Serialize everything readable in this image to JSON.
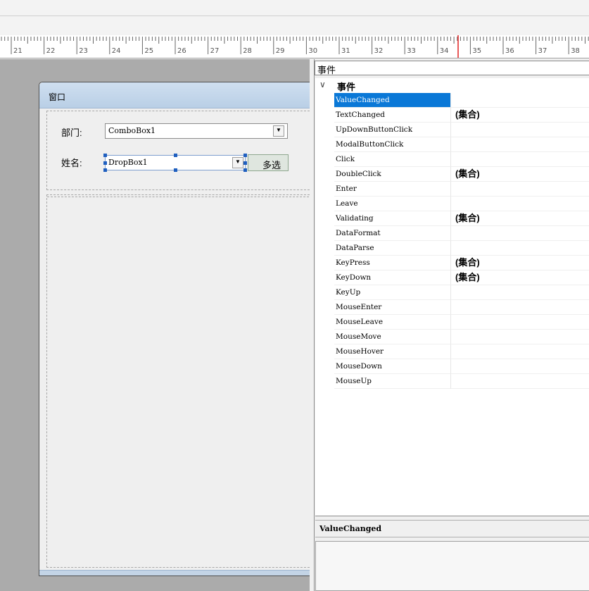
{
  "ruler": {
    "labels": [
      "21",
      "22",
      "23",
      "24",
      "25",
      "26",
      "27",
      "28",
      "29",
      "30",
      "31",
      "32",
      "33",
      "34",
      "35",
      "36",
      "37",
      "38"
    ]
  },
  "designer": {
    "window_title": "窗口",
    "fields": [
      {
        "label": "部门:",
        "value": "ComboBox1"
      },
      {
        "label": "姓名:",
        "value": "DropBox1",
        "button": "多选"
      }
    ]
  },
  "property_grid": {
    "search_value": "事件",
    "category": "事件",
    "rows": [
      {
        "name": "ValueChanged",
        "value": "",
        "selected": true
      },
      {
        "name": "TextChanged",
        "value": "(集合)"
      },
      {
        "name": "UpDownButtonClick",
        "value": ""
      },
      {
        "name": "ModalButtonClick",
        "value": ""
      },
      {
        "name": "Click",
        "value": ""
      },
      {
        "name": "DoubleClick",
        "value": "(集合)"
      },
      {
        "name": "Enter",
        "value": ""
      },
      {
        "name": "Leave",
        "value": ""
      },
      {
        "name": "Validating",
        "value": "(集合)"
      },
      {
        "name": "DataFormat",
        "value": ""
      },
      {
        "name": "DataParse",
        "value": ""
      },
      {
        "name": "KeyPress",
        "value": "(集合)"
      },
      {
        "name": "KeyDown",
        "value": "(集合)"
      },
      {
        "name": "KeyUp",
        "value": ""
      },
      {
        "name": "MouseEnter",
        "value": ""
      },
      {
        "name": "MouseLeave",
        "value": ""
      },
      {
        "name": "MouseMove",
        "value": ""
      },
      {
        "name": "MouseHover",
        "value": ""
      },
      {
        "name": "MouseDown",
        "value": ""
      },
      {
        "name": "MouseUp",
        "value": ""
      }
    ],
    "description_title": "ValueChanged",
    "description_text": ""
  },
  "colors": {
    "selection": "#0a78d7",
    "ruler_marker": "#e02020",
    "canvas": "#ababab",
    "title_bar": "#c6d8ec"
  }
}
